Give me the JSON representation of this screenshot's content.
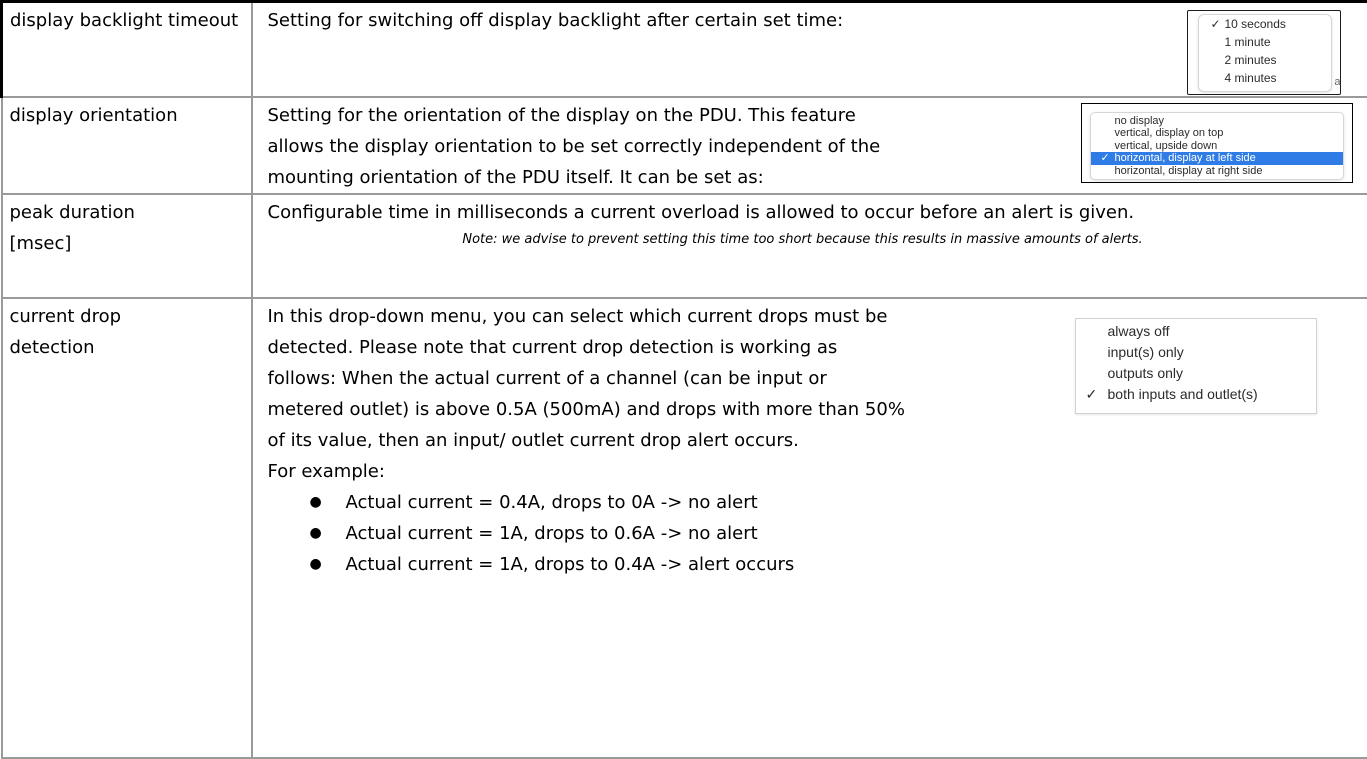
{
  "rows": [
    {
      "setting": "display backlight timeout",
      "description": "Setting for switching off display backlight after certain set time:",
      "menu": {
        "items": [
          {
            "label": "10 seconds",
            "checked": true
          },
          {
            "label": "1 minute",
            "checked": false
          },
          {
            "label": "2 minutes",
            "checked": false
          },
          {
            "label": "4 minutes",
            "checked": false
          }
        ],
        "edge_glyph": "a"
      }
    },
    {
      "setting": "display orientation",
      "description_lines": [
        "Setting for the orientation of the display on the PDU. This feature",
        "allows the display orientation to be set correctly independent of the",
        "mounting orientation of the PDU itself. It can be set as:"
      ],
      "menu": {
        "items": [
          {
            "label": "no display",
            "checked": false
          },
          {
            "label": "vertical, display on top",
            "checked": false
          },
          {
            "label": "vertical, upside down",
            "checked": false
          },
          {
            "label": "horizontal, display at left side",
            "checked": true,
            "selected": true
          },
          {
            "label": "horizontal, display at right side",
            "checked": false
          }
        ],
        "highlight_color": "#2f7ce6"
      }
    },
    {
      "setting_lines": [
        "peak duration",
        "[msec]"
      ],
      "description": "Configurable time in milliseconds a current overload is allowed to occur before an alert is given.",
      "note": "Note: we advise to prevent setting this time too short because this results in massive amounts of alerts."
    },
    {
      "setting_lines": [
        "current drop",
        "detection"
      ],
      "description_lines": [
        "In this drop-down menu, you can select which current drops must be",
        "detected. Please note that current drop detection is working as",
        "follows: When the actual current of a channel (can be input or",
        "metered outlet) is above 0.5A (500mA) and drops with more than 50%",
        "of its value, then an input/ outlet current drop alert occurs.",
        "For example:"
      ],
      "bullets": [
        "Actual current = 0.4A, drops to 0A -> no alert",
        "Actual current = 1A, drops to 0.6A -> no alert",
        "Actual current = 1A, drops to 0.4A -> alert occurs"
      ],
      "menu": {
        "items": [
          {
            "label": "always off",
            "checked": false
          },
          {
            "label": "input(s) only",
            "checked": false
          },
          {
            "label": "outputs only",
            "checked": false
          },
          {
            "label": "both inputs and outlet(s)",
            "checked": true
          }
        ]
      }
    }
  ],
  "icons": {
    "check": "checkmark-icon",
    "bullet": "bullet-icon"
  },
  "glyphs": {
    "check": "✓",
    "bullet": "●"
  }
}
